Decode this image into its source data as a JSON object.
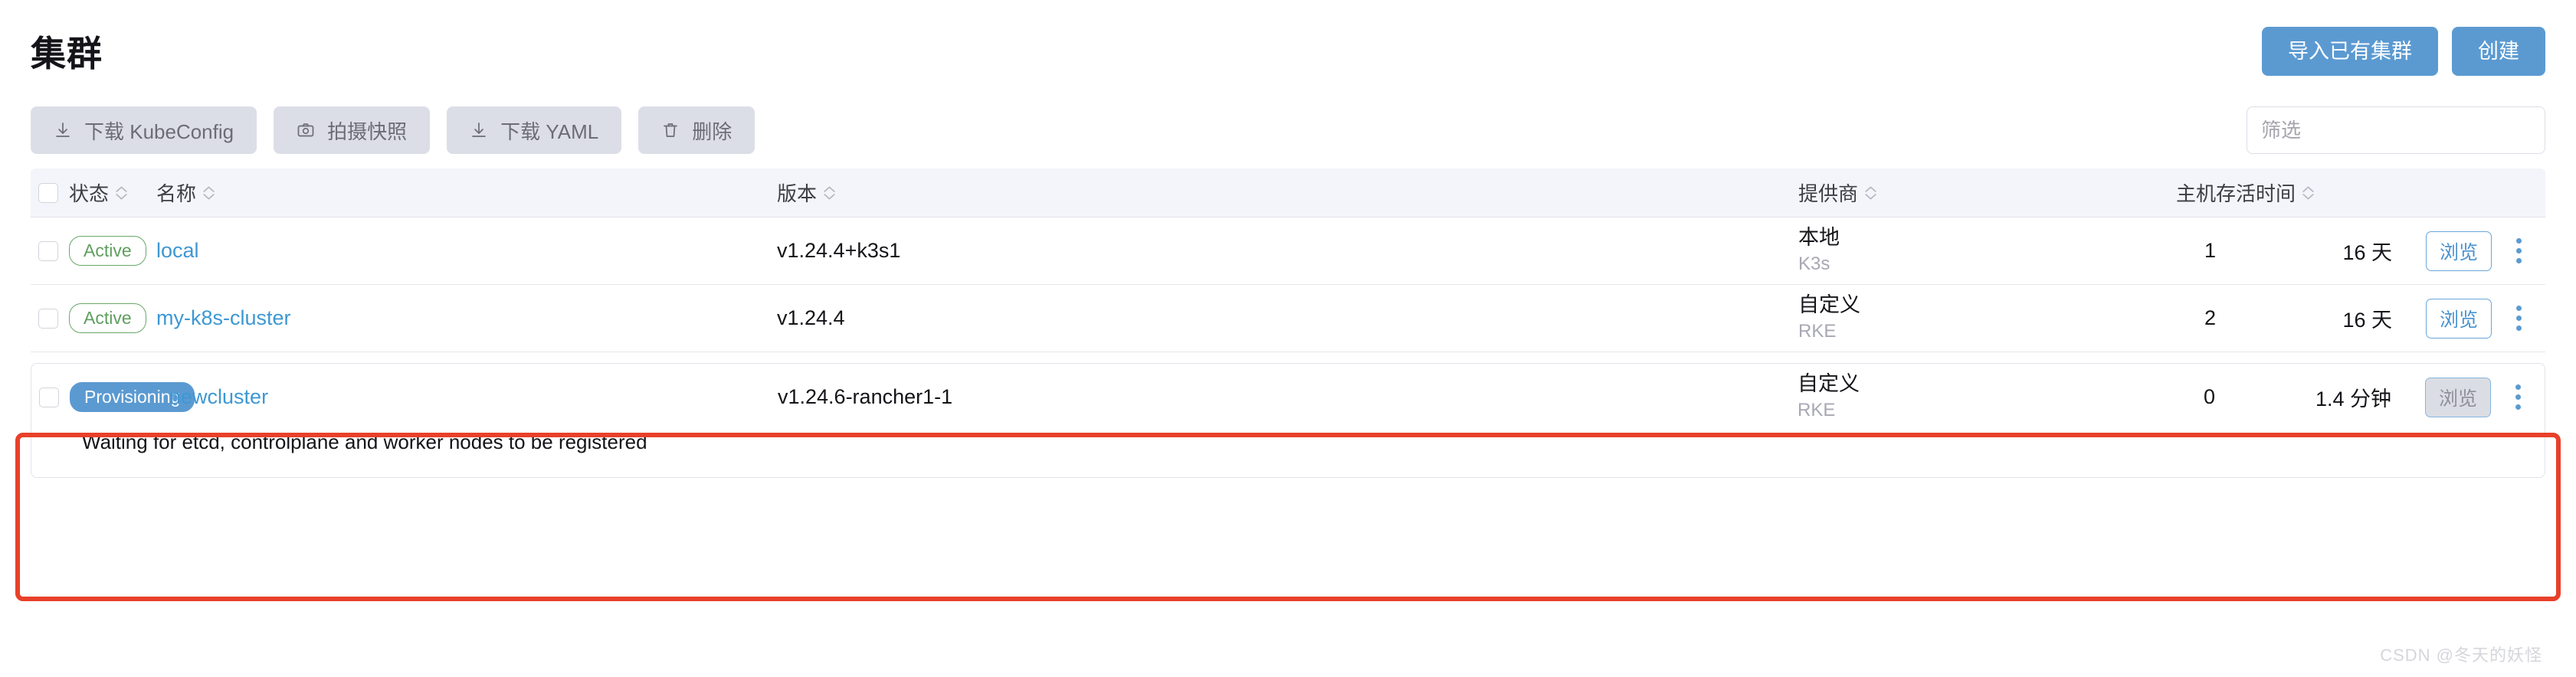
{
  "header": {
    "title": "集群",
    "import_button": "导入已有集群",
    "create_button": "创建"
  },
  "toolbar": {
    "buttons": [
      {
        "label": "下载 KubeConfig",
        "icon": "download-icon"
      },
      {
        "label": "拍摄快照",
        "icon": "camera-icon"
      },
      {
        "label": "下载 YAML",
        "icon": "download-icon"
      },
      {
        "label": "删除",
        "icon": "trash-icon"
      }
    ],
    "filter_placeholder": "筛选",
    "filter_value": ""
  },
  "table": {
    "columns": {
      "status": "状态",
      "name": "名称",
      "version": "版本",
      "provider": "提供商",
      "hosts": "主机",
      "age": "存活时间"
    },
    "rows": [
      {
        "status": "Active",
        "status_kind": "active",
        "name": "local",
        "version": "v1.24.4+k3s1",
        "provider": "本地",
        "provider_sub": "K3s",
        "hosts": "1",
        "age": "16 天",
        "browse": "浏览",
        "browse_disabled": false,
        "message": ""
      },
      {
        "status": "Active",
        "status_kind": "active",
        "name": "my-k8s-cluster",
        "version": "v1.24.4",
        "provider": "自定义",
        "provider_sub": "RKE",
        "hosts": "2",
        "age": "16 天",
        "browse": "浏览",
        "browse_disabled": false,
        "message": ""
      },
      {
        "status": "Provisioning",
        "status_kind": "provisioning",
        "name": "newcluster",
        "version": "v1.24.6-rancher1-1",
        "provider": "自定义",
        "provider_sub": "RKE",
        "hosts": "0",
        "age": "1.4 分钟",
        "browse": "浏览",
        "browse_disabled": true,
        "message": "Waiting for etcd, controlplane and worker nodes to be registered"
      }
    ]
  },
  "highlight": {
    "color": "#e8402a"
  },
  "watermark": "CSDN @冬天的妖怪",
  "colors": {
    "primary": "#5b9ad1",
    "link": "#3d98d3",
    "active_green": "#5f9e5f",
    "highlight_red": "#e8402a"
  }
}
